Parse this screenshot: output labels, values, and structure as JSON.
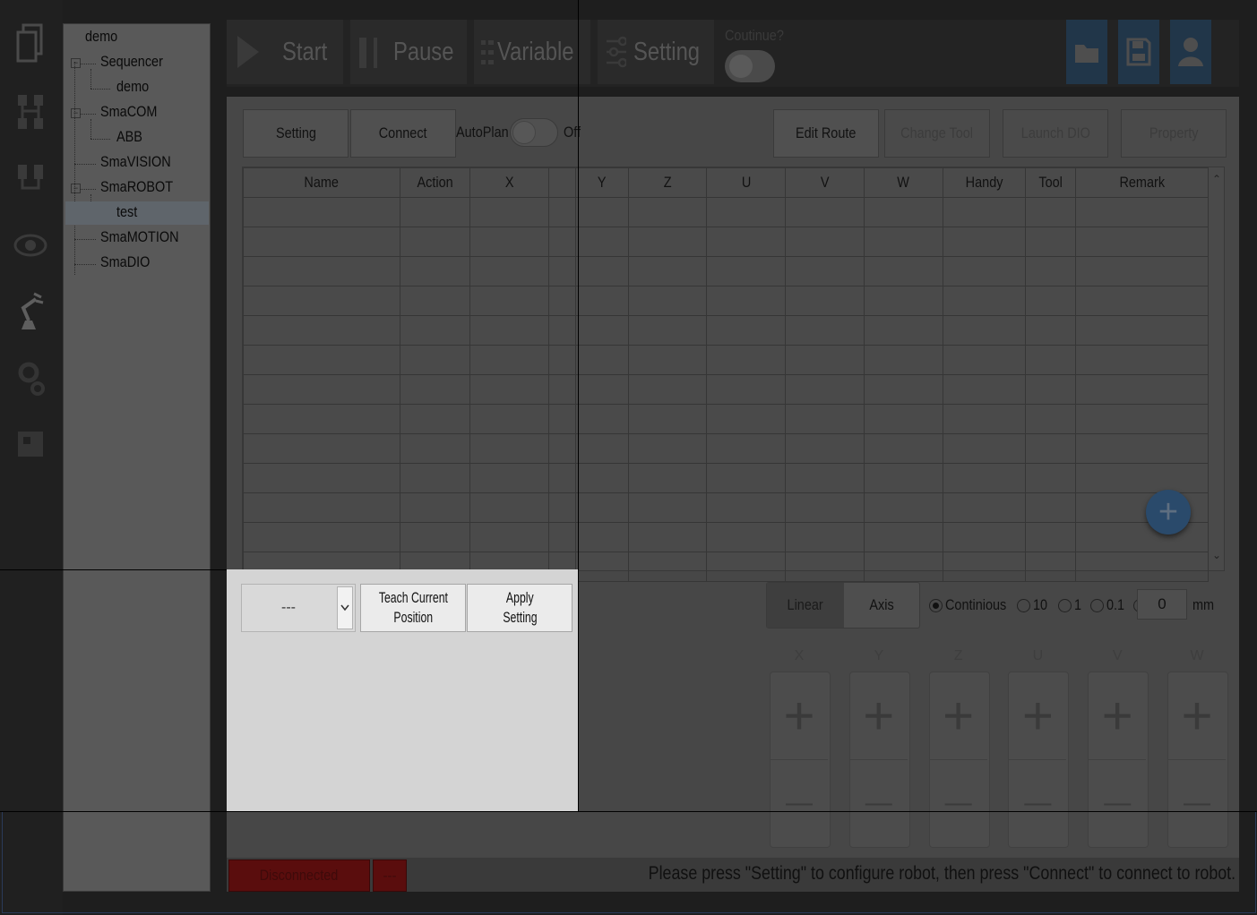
{
  "tree": {
    "items": [
      {
        "label": "demo"
      },
      {
        "label": "Sequencer"
      },
      {
        "label": "demo"
      },
      {
        "label": "SmaCOM"
      },
      {
        "label": "ABB"
      },
      {
        "label": "SmaVISION"
      },
      {
        "label": "SmaROBOT"
      },
      {
        "label": "test"
      },
      {
        "label": "SmaMOTION"
      },
      {
        "label": "SmaDIO"
      }
    ]
  },
  "toolbar": {
    "start_label": "Start",
    "pause_label": "Pause",
    "variable_label": "Variable",
    "setting_label": "Setting",
    "continue_label": "Coutinue?"
  },
  "panel": {
    "setting_label": "Setting",
    "connect_label": "Connect",
    "autoplan_label": "AutoPlan",
    "autoplan_state": "Off",
    "edit_route_label": "Edit Route",
    "change_tool_label": "Change Tool",
    "launch_dio_label": "Launch DIO",
    "property_label": "Property"
  },
  "table": {
    "columns": [
      "Name",
      "Action",
      "X",
      "",
      "Y",
      "Z",
      "U",
      "V",
      "W",
      "Handy",
      "Tool",
      "Remark"
    ],
    "row_count": 13
  },
  "popup": {
    "select_value": "---",
    "teach_label_1": "Teach Current",
    "teach_label_2": "Position",
    "apply_label_1": "Apply",
    "apply_label_2": "Setting"
  },
  "jog": {
    "linear_label": "Linear",
    "axis_label": "Axis",
    "step_options": [
      "Continious",
      "10",
      "1",
      "0.1"
    ],
    "custom_value": "0",
    "unit": "mm",
    "axes": [
      "X",
      "Y",
      "Z",
      "U",
      "V",
      "W"
    ]
  },
  "status": {
    "connection": "Disconnected",
    "secondary": "---",
    "message": "Please press \"Setting\" to configure robot, then press \"Connect\" to connect to robot."
  },
  "colors": {
    "accent": "#213649",
    "fab": "#2a4a6b",
    "disconnected": "#5a0d0d"
  }
}
